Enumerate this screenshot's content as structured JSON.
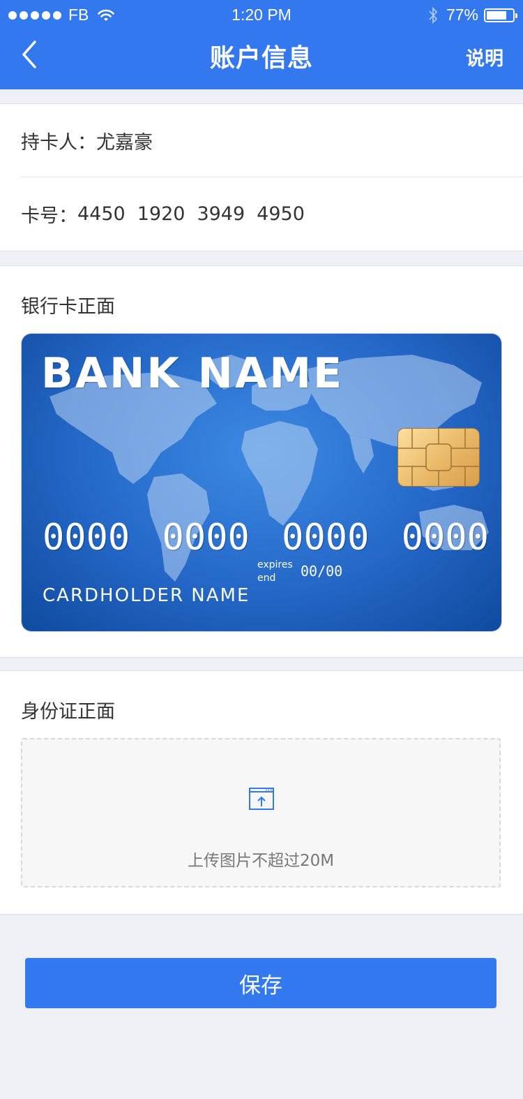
{
  "status_bar": {
    "carrier": "FB",
    "time": "1:20 PM",
    "battery_percent": "77%",
    "battery_level": 0.77
  },
  "navbar": {
    "title": "账户信息",
    "help_label": "说明"
  },
  "account": {
    "holder_label": "持卡人：",
    "holder_name": "尤嘉豪",
    "number_label": "卡号：",
    "number_groups": [
      "4450",
      "1920",
      "3949",
      "4950"
    ]
  },
  "bank_card_section": {
    "title": "银行卡正面",
    "card": {
      "bank_name": "BANK NAME",
      "digits": [
        "0000",
        "0000",
        "0000",
        "0000"
      ],
      "expires_label_1": "expires",
      "expires_label_2": "end",
      "expires_value": "00/00",
      "cardholder": "CARDHOLDER NAME"
    }
  },
  "id_section": {
    "title": "身份证正面",
    "upload_hint": "上传图片不超过20M"
  },
  "save_label": "保存",
  "colors": {
    "primary": "#3478f0",
    "background": "#eef0f5"
  },
  "icons": {
    "back": "chevron-left-icon",
    "wifi": "wifi-icon",
    "bluetooth": "bluetooth-icon",
    "battery": "battery-icon",
    "upload": "upload-icon"
  }
}
